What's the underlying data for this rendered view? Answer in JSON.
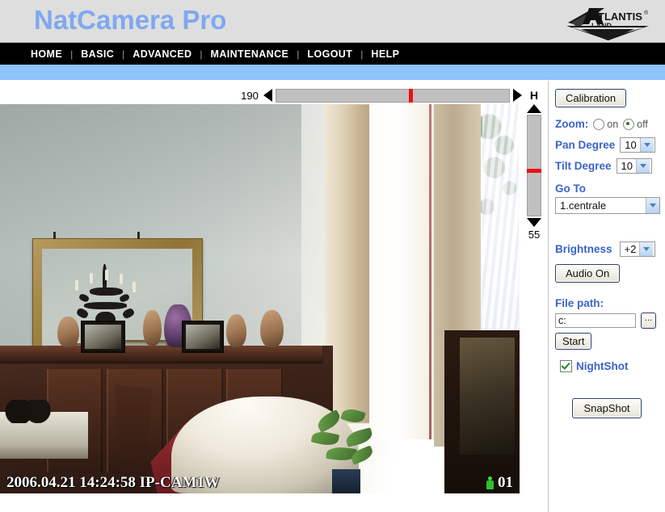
{
  "header": {
    "brand_title": "NatCamera Pro",
    "logo_primary": "ATLANTIS",
    "logo_reg": "®",
    "logo_secondary": "LAND",
    "bg_color": "#dedede",
    "title_color": "#7fa8f0"
  },
  "nav": {
    "separator": "|",
    "items": [
      {
        "label": "HOME"
      },
      {
        "label": "BASIC"
      },
      {
        "label": "ADVANCED"
      },
      {
        "label": "MAINTENANCE"
      },
      {
        "label": "LOGOUT"
      },
      {
        "label": "HELP"
      }
    ],
    "bar_color": "#000000",
    "band_color": "#8cc4fb"
  },
  "pan_slider": {
    "value": "190",
    "axis_label": "H",
    "left_arrow_icon": "triangle-left-icon",
    "right_arrow_icon": "triangle-right-icon",
    "thumb_percent": 57,
    "thumb_color": "#ee1111",
    "track_color": "#c0c0c0"
  },
  "tilt_slider": {
    "value": "55",
    "up_arrow_icon": "triangle-up-icon",
    "down_arrow_icon": "triangle-down-icon",
    "thumb_percent": 53,
    "thumb_color": "#ee1111",
    "track_color": "#c0c0c0"
  },
  "video": {
    "timestamp": "2006.04.21 14:24:58 IP-CAM1W",
    "channel": "01",
    "status_icon": "person-icon",
    "scene_description": "living room with gold framed mirror, chandelier reflection, wooden sideboard, sofa with red blanket, potted plant and bright curtained window"
  },
  "panel": {
    "calibration_button": "Calibration",
    "zoom": {
      "label": "Zoom:",
      "on_label": "on",
      "off_label": "off",
      "selected": "off"
    },
    "pan_degree": {
      "label": "Pan Degree",
      "value": "10"
    },
    "tilt_degree": {
      "label": "Tilt Degree",
      "value": "10"
    },
    "go_to": {
      "label": "Go To",
      "value": "1.centrale"
    },
    "brightness": {
      "label": "Brightness",
      "value": "+2"
    },
    "audio_button": "Audio On",
    "file_path": {
      "label": "File path:",
      "value": "c:",
      "browse_button": "..."
    },
    "start_button": "Start",
    "night_shot": {
      "label": "NightShot",
      "checked": true
    },
    "snapshot_button": "SnapShot",
    "label_color": "#3a63c8"
  }
}
